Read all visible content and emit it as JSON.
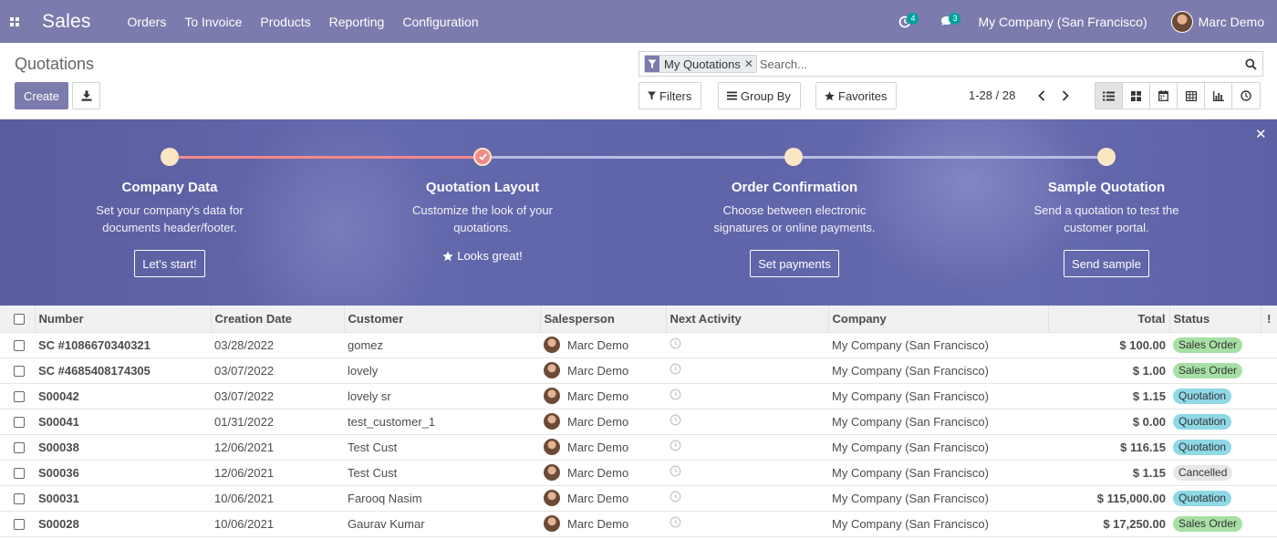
{
  "navbar": {
    "app_name": "Sales",
    "menu": [
      "Orders",
      "To Invoice",
      "Products",
      "Reporting",
      "Configuration"
    ],
    "activity_count": "4",
    "message_count": "3",
    "company": "My Company (San Francisco)",
    "user": "Marc Demo"
  },
  "control_panel": {
    "title": "Quotations",
    "create_label": "Create",
    "facet_label": "My Quotations",
    "search_placeholder": "Search...",
    "filters_label": "Filters",
    "group_by_label": "Group By",
    "favorites_label": "Favorites",
    "pager_value": "1-28 / 28"
  },
  "banner": {
    "steps": [
      {
        "title": "Company Data",
        "desc_line1": "Set your company's data for",
        "desc_line2": "documents header/footer.",
        "button": "Let's start!"
      },
      {
        "title": "Quotation Layout",
        "desc_line1": "Customize the look of your",
        "desc_line2": "quotations.",
        "done_label": "Looks great!"
      },
      {
        "title": "Order Confirmation",
        "desc_line1": "Choose between electronic",
        "desc_line2": "signatures or online payments.",
        "button": "Set payments"
      },
      {
        "title": "Sample Quotation",
        "desc_line1": "Send a quotation to test the",
        "desc_line2": "customer portal.",
        "button": "Send sample"
      }
    ]
  },
  "table": {
    "headers": {
      "number": "Number",
      "creation_date": "Creation Date",
      "customer": "Customer",
      "salesperson": "Salesperson",
      "next_activity": "Next Activity",
      "company": "Company",
      "total": "Total",
      "status": "Status",
      "optional": "!"
    },
    "rows": [
      {
        "number": "SC #1086670340321",
        "date": "03/28/2022",
        "customer": "gomez",
        "salesperson": "Marc Demo",
        "company": "My Company (San Francisco)",
        "total": "$ 100.00",
        "status": "Sales Order"
      },
      {
        "number": "SC #4685408174305",
        "date": "03/07/2022",
        "customer": "lovely",
        "salesperson": "Marc Demo",
        "company": "My Company (San Francisco)",
        "total": "$ 1.00",
        "status": "Sales Order"
      },
      {
        "number": "S00042",
        "date": "03/07/2022",
        "customer": "lovely sr",
        "salesperson": "Marc Demo",
        "company": "My Company (San Francisco)",
        "total": "$ 1.15",
        "status": "Quotation"
      },
      {
        "number": "S00041",
        "date": "01/31/2022",
        "customer": "test_customer_1",
        "salesperson": "Marc Demo",
        "company": "My Company (San Francisco)",
        "total": "$ 0.00",
        "status": "Quotation"
      },
      {
        "number": "S00038",
        "date": "12/06/2021",
        "customer": "Test Cust",
        "salesperson": "Marc Demo",
        "company": "My Company (San Francisco)",
        "total": "$ 116.15",
        "status": "Quotation"
      },
      {
        "number": "S00036",
        "date": "12/06/2021",
        "customer": "Test Cust",
        "salesperson": "Marc Demo",
        "company": "My Company (San Francisco)",
        "total": "$ 1.15",
        "status": "Cancelled"
      },
      {
        "number": "S00031",
        "date": "10/06/2021",
        "customer": "Farooq Nasim",
        "salesperson": "Marc Demo",
        "company": "My Company (San Francisco)",
        "total": "$ 115,000.00",
        "status": "Quotation"
      },
      {
        "number": "S00028",
        "date": "10/06/2021",
        "customer": "Gaurav Kumar",
        "salesperson": "Marc Demo",
        "company": "My Company (San Francisco)",
        "total": "$ 17,250.00",
        "status": "Sales Order"
      }
    ]
  },
  "colors": {
    "navbar": "#7c7bad",
    "primary_button": "#7c7bad",
    "status_sales_order": "#a7e0a4",
    "status_quotation": "#8fd8e6",
    "status_cancelled": "#e6e6e6",
    "badge_teal": "#00a09d"
  },
  "icons": {
    "apps": "apps-grid-icon",
    "activity": "clock-icon",
    "messages": "chat-icon",
    "download": "download-icon",
    "facet": "filter-funnel-icon",
    "search": "magnifier-icon",
    "close": "close-icon",
    "views": [
      "list-view-icon",
      "kanban-view-icon",
      "calendar-view-icon",
      "pivot-view-icon",
      "graph-view-icon",
      "activity-view-icon"
    ]
  }
}
